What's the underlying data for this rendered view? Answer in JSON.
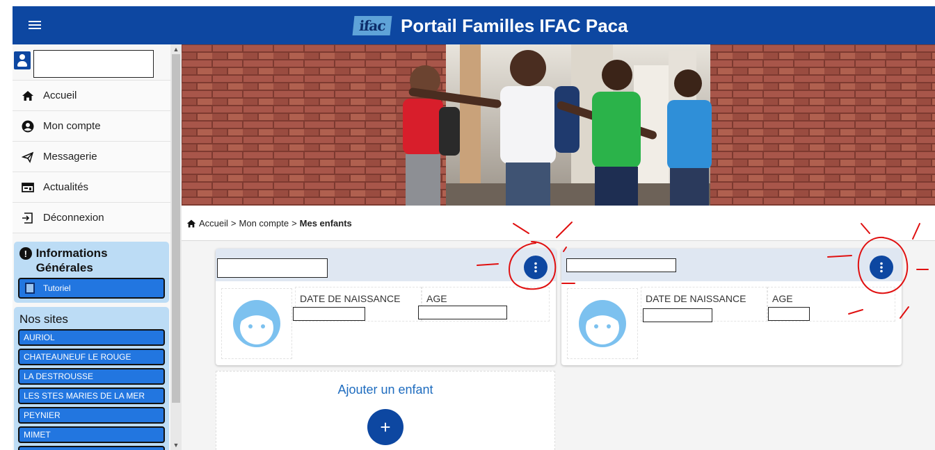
{
  "header": {
    "menu_icon": "hamburger-icon",
    "logo_text": "ifac",
    "title": "Portail Familles IFAC Paca"
  },
  "sidebar": {
    "user_name": "",
    "items": [
      {
        "label": "Accueil",
        "icon": "home-icon"
      },
      {
        "label": "Mon compte",
        "icon": "account-icon"
      },
      {
        "label": "Messagerie",
        "icon": "message-icon"
      },
      {
        "label": "Actualités",
        "icon": "news-icon"
      },
      {
        "label": "Déconnexion",
        "icon": "logout-icon"
      }
    ],
    "info_panel": {
      "title": "Informations Générales",
      "tutorial_label": "Tutoriel"
    },
    "sites_panel": {
      "title": "Nos sites",
      "sites": [
        "AURIOL",
        "CHATEAUNEUF LE ROUGE",
        "LA DESTROUSSE",
        "LES STES MARIES DE LA MER",
        "PEYNIER",
        "MIMET"
      ]
    }
  },
  "breadcrumb": {
    "home": "Accueil",
    "sep1": ">",
    "account": "Mon compte",
    "sep2": ">",
    "current": "Mes enfants"
  },
  "children": [
    {
      "name": "",
      "birth_label": "DATE DE NAISSANCE",
      "birth_value": "",
      "age_label": "AGE",
      "age_value": ""
    },
    {
      "name": "",
      "birth_label": "DATE DE NAISSANCE",
      "birth_value": "",
      "age_label": "AGE",
      "age_value": ""
    }
  ],
  "add_child": {
    "label": "Ajouter un enfant",
    "button": "+"
  },
  "colors": {
    "primary": "#0d47a1",
    "panel": "#bcdcf5",
    "site_button": "#2276e0",
    "annotation": "#e01010"
  }
}
